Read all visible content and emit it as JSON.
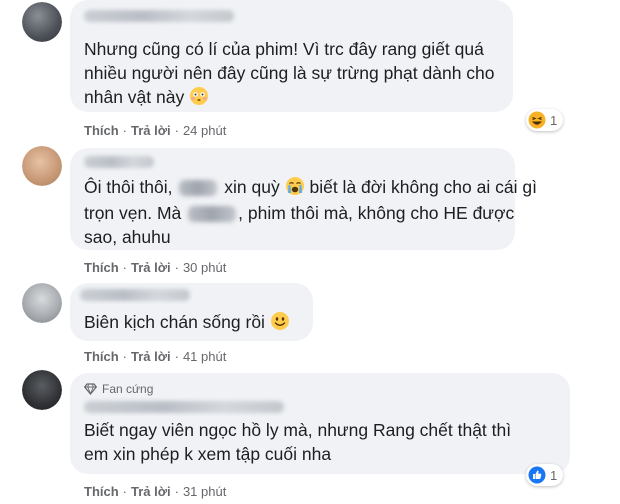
{
  "comments": [
    {
      "lines": [
        "Nhưng cũng có lí của phim! Vì trc đây rang giết quá",
        "nhiều người nên đây cũng là sự trừng phạt dành cho",
        "nhân vật này"
      ],
      "like_label": "Thích",
      "reply_label": "Trả lời",
      "time": "24 phút",
      "reaction_count": "1",
      "reaction_icon": "haha-icon"
    },
    {
      "line1_a": "Ôi thôi thôi,",
      "line1_b": "xin quỳ",
      "line1_c": "biết là đời không cho ai cái gì",
      "line2_a": "trọn vẹn. Mà",
      "line2_b": ", phim thôi mà, không cho HE được",
      "line3": "sao, ahuhu",
      "like_label": "Thích",
      "reply_label": "Trả lời",
      "time": "30 phút"
    },
    {
      "line1": "Biên kịch chán sống rồi",
      "like_label": "Thích",
      "reply_label": "Trả lời",
      "time": "41 phút"
    },
    {
      "badge": "Fan cứng",
      "lines": [
        "Biết ngay viên ngọc hồ ly mà, nhưng Rang chết thật thì",
        "em xin phép k xem tập cuối nha"
      ],
      "like_label": "Thích",
      "reply_label": "Trả lời",
      "time": "31 phút",
      "reaction_count": "1",
      "reaction_icon": "like-icon"
    }
  ],
  "separator": "·",
  "colors": {
    "bubble": "#f0f2f5",
    "meta": "#65676b",
    "like_blue": "#1877f2",
    "haha_yellow": "#f7b125"
  }
}
